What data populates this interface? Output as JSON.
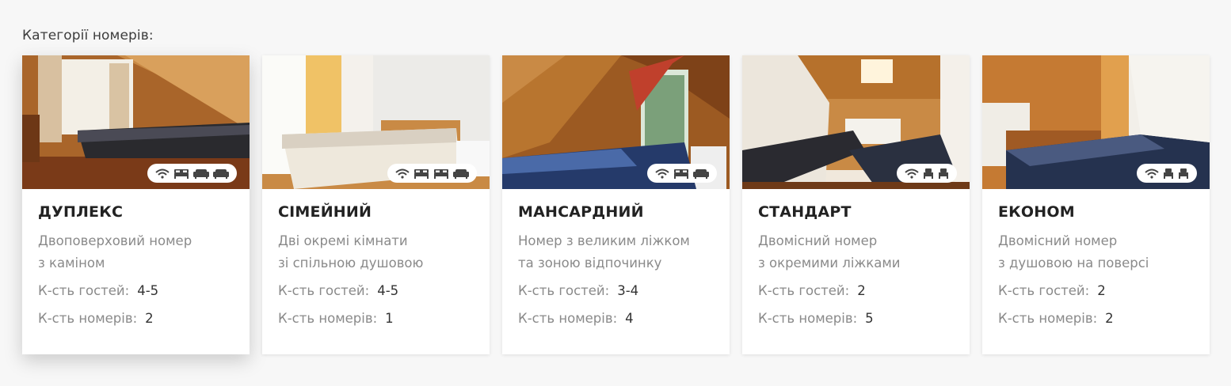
{
  "section_title": "Категорії номерів:",
  "guests_label": "К-сть гостей:",
  "rooms_label": "К-сть номерів:",
  "cards": [
    {
      "title": "ДУПЛЕКС",
      "desc_line1": "Двоповерховий номер",
      "desc_line2": "з каміном",
      "guests": "4-5",
      "rooms": "2",
      "amenities": [
        "wifi-icon",
        "bed-icon",
        "sofa-icon",
        "sofa-icon"
      ]
    },
    {
      "title": "СІМЕЙНИЙ",
      "desc_line1": "Дві окремі кімнати",
      "desc_line2": "зі спільною душовою",
      "guests": "4-5",
      "rooms": "1",
      "amenities": [
        "wifi-icon",
        "bed-icon",
        "bed-icon",
        "sofa-icon"
      ]
    },
    {
      "title": "МАНСАРДНИЙ",
      "desc_line1": "Номер з великим ліжком",
      "desc_line2": "та зоною відпочинку",
      "guests": "3-4",
      "rooms": "4",
      "amenities": [
        "wifi-icon",
        "bed-icon",
        "sofa-icon"
      ]
    },
    {
      "title": "СТАНДАРТ",
      "desc_line1": "Двомісний номер",
      "desc_line2": "з окремими ліжками",
      "guests": "2",
      "rooms": "5",
      "amenities": [
        "wifi-icon",
        "single-bed-icon",
        "single-bed-icon"
      ]
    },
    {
      "title": "ЕКОНОМ",
      "desc_line1": "Двомісний номер",
      "desc_line2": "з душовою на поверсі",
      "guests": "2",
      "rooms": "2",
      "amenities": [
        "wifi-icon",
        "single-bed-icon",
        "single-bed-icon"
      ]
    }
  ]
}
